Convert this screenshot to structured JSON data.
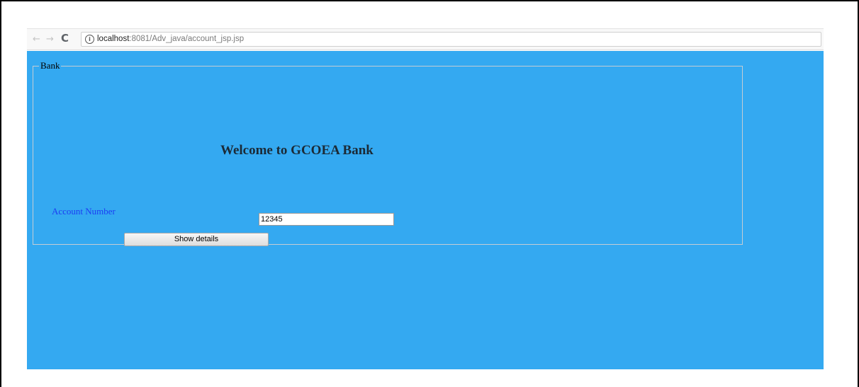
{
  "browser": {
    "url_host": "localhost",
    "url_rest": ":8081/Adv_java/account_jsp.jsp",
    "nav_back_glyph": "←",
    "nav_forward_glyph": "→",
    "reload_glyph": "C",
    "info_glyph": "i"
  },
  "page": {
    "background_color": "#34a9f1",
    "fieldset_legend": "Bank",
    "welcome_heading": "Welcome to GCOEA Bank",
    "account_label": "Account Number",
    "account_input_value": "12345",
    "show_details_label": "Show details"
  }
}
